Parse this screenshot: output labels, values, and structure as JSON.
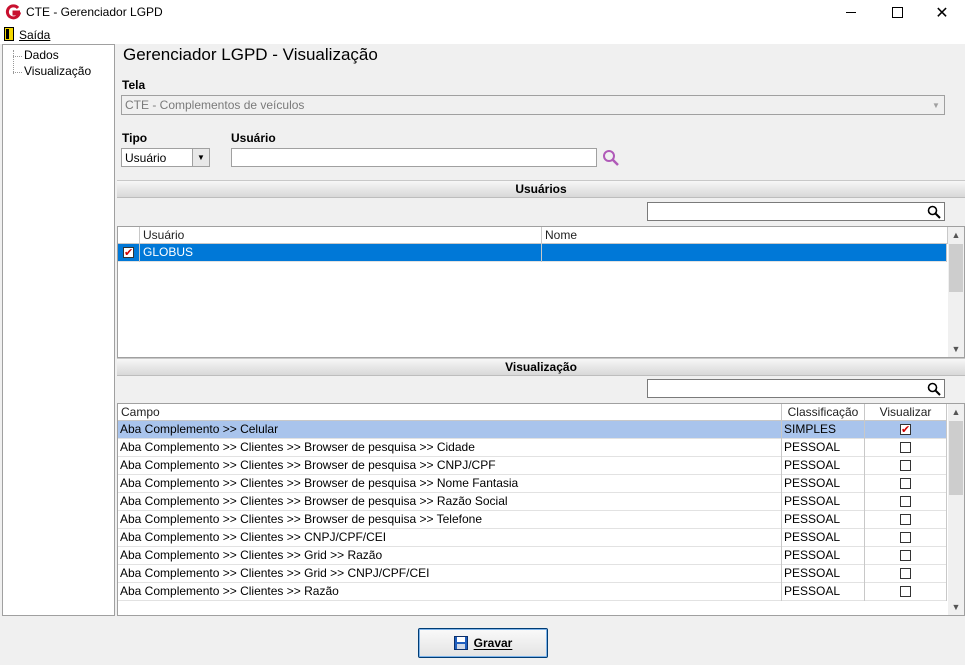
{
  "window": {
    "title": "CTE - Gerenciador LGPD"
  },
  "menu": {
    "exit_label": "Saída"
  },
  "tree": {
    "items": [
      "Dados",
      "Visualização"
    ]
  },
  "page": {
    "title": "Gerenciador LGPD - Visualização"
  },
  "form": {
    "tela_label": "Tela",
    "tela_value": "CTE - Complementos de veículos",
    "tipo_label": "Tipo",
    "tipo_value": "Usuário",
    "usuario_label": "Usuário",
    "usuario_value": ""
  },
  "users_section": {
    "title": "Usuários",
    "search_value": "",
    "columns": [
      "Usuário",
      "Nome"
    ],
    "rows": [
      {
        "checked": true,
        "usuario": "GLOBUS",
        "nome": ""
      }
    ]
  },
  "view_section": {
    "title": "Visualização",
    "search_value": "",
    "columns": [
      "Campo",
      "Classificação",
      "Visualizar"
    ],
    "rows": [
      {
        "campo": "Aba Complemento >> Celular",
        "classificacao": "SIMPLES",
        "visualizar": true
      },
      {
        "campo": "Aba Complemento >> Clientes >> Browser de pesquisa >> Cidade",
        "classificacao": "PESSOAL",
        "visualizar": false
      },
      {
        "campo": "Aba Complemento >> Clientes >> Browser de pesquisa >> CNPJ/CPF",
        "classificacao": "PESSOAL",
        "visualizar": false
      },
      {
        "campo": "Aba Complemento >> Clientes >> Browser de pesquisa >> Nome Fantasia",
        "classificacao": "PESSOAL",
        "visualizar": false
      },
      {
        "campo": "Aba Complemento >> Clientes >> Browser de pesquisa >> Razão Social",
        "classificacao": "PESSOAL",
        "visualizar": false
      },
      {
        "campo": "Aba Complemento >> Clientes >> Browser de pesquisa >> Telefone",
        "classificacao": "PESSOAL",
        "visualizar": false
      },
      {
        "campo": "Aba Complemento >> Clientes >> CNPJ/CPF/CEI",
        "classificacao": "PESSOAL",
        "visualizar": false
      },
      {
        "campo": "Aba Complemento >> Clientes >> Grid >>  Razão",
        "classificacao": "PESSOAL",
        "visualizar": false
      },
      {
        "campo": "Aba Complemento >> Clientes >> Grid >> CNPJ/CPF/CEI",
        "classificacao": "PESSOAL",
        "visualizar": false
      },
      {
        "campo": "Aba Complemento >> Clientes >> Razão",
        "classificacao": "PESSOAL",
        "visualizar": false
      }
    ]
  },
  "buttons": {
    "save_label": "Gravar"
  },
  "colors": {
    "selection": "#0078d7",
    "highlight_row": "#a9c4ec",
    "search_icon": "#b05ab8"
  }
}
